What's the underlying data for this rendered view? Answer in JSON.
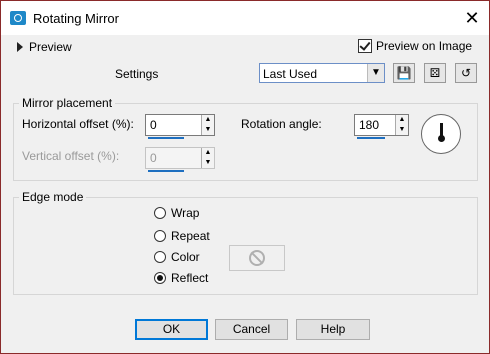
{
  "window": {
    "title": "Rotating Mirror",
    "close_glyph": "✕"
  },
  "preview": {
    "expander_label": "Preview",
    "checkbox_label": "Preview on Image",
    "checkbox_checked": true
  },
  "settings": {
    "label": "Settings",
    "preset_value": "Last Used",
    "buttons": [
      {
        "name": "save-preset-icon",
        "glyph": "💾"
      },
      {
        "name": "randomize-icon",
        "glyph": "⚄"
      },
      {
        "name": "reset-icon",
        "glyph": "↺"
      }
    ]
  },
  "mirror_placement": {
    "title": "Mirror placement",
    "horizontal_offset_label": "Horizontal offset (%):",
    "horizontal_offset_value": "0",
    "vertical_offset_label": "Vertical offset (%):",
    "vertical_offset_value": "0",
    "rotation_label": "Rotation angle:",
    "rotation_value": "180"
  },
  "edge_mode": {
    "title": "Edge mode",
    "options": [
      {
        "label": "Wrap",
        "checked": false
      },
      {
        "label": "Repeat",
        "checked": false
      },
      {
        "label": "Color",
        "checked": false
      },
      {
        "label": "Reflect",
        "checked": true
      }
    ]
  },
  "footer": {
    "ok": "OK",
    "cancel": "Cancel",
    "help": "Help"
  }
}
